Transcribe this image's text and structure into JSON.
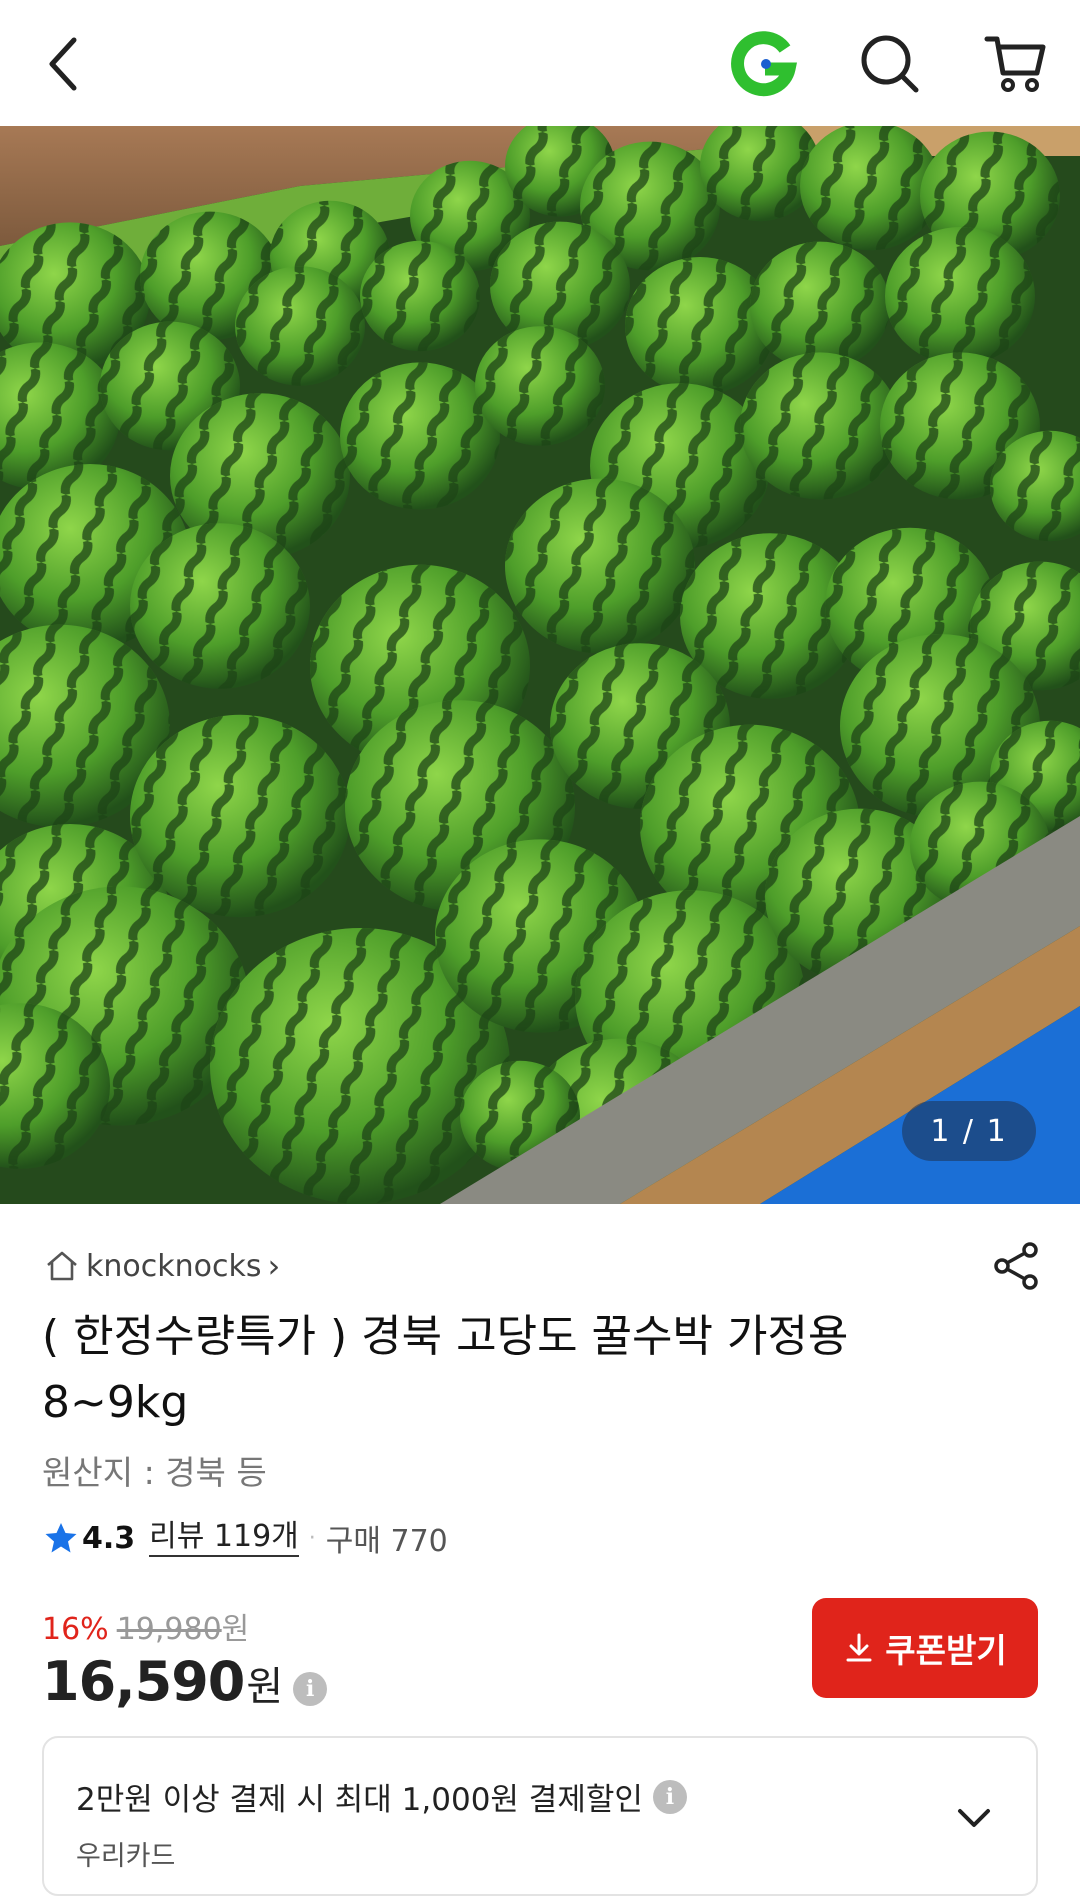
{
  "header": {
    "back_icon": "chevron-left-icon",
    "brand_icon": "g-logo-icon",
    "search_icon": "search-icon",
    "cart_icon": "cart-icon",
    "brand_color": "#2fbf2f"
  },
  "gallery": {
    "counter": "1 / 1",
    "image_subject": "watermelons"
  },
  "product": {
    "store_icon": "home-icon",
    "store_name": "knocknocks",
    "store_chevron": "›",
    "share_icon": "share-icon",
    "title_line1": "( 한정수량특가 ) 경북 고당도 꿀수박 가정용",
    "title_line2": "8~9kg",
    "origin": "원산지 : 경북 등",
    "rating_icon": "star-icon",
    "rating": "4.3",
    "reviews": "리뷰 119개",
    "separator": "·",
    "purchases": "구매 770",
    "star_color": "#1a73e8"
  },
  "price": {
    "discount": "16%",
    "original": "19,980",
    "original_unit": "원",
    "sale": "16,590",
    "sale_unit": "원",
    "info_icon": "info-icon",
    "accent_color": "#e0241b"
  },
  "coupon": {
    "icon": "download-icon",
    "label": "쿠폰받기"
  },
  "promo": {
    "text": "2만원 이상 결제 시 최대 1,000원 결제할인",
    "info_icon": "info-icon",
    "card": "우리카드",
    "chevron": "chevron-down-icon"
  }
}
